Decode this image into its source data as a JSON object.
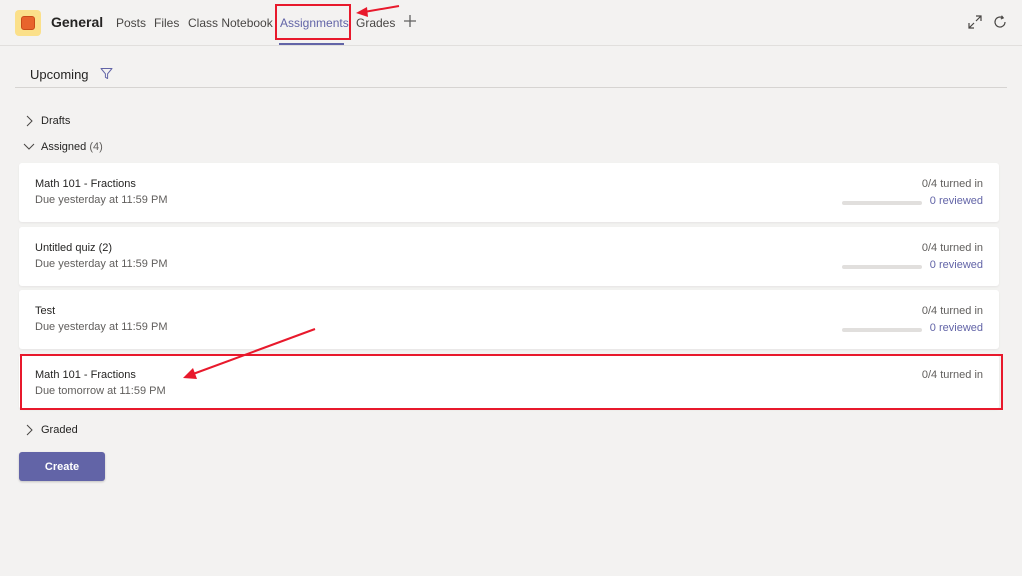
{
  "header": {
    "channel_name": "General",
    "tabs": [
      {
        "label": "Posts",
        "active": false
      },
      {
        "label": "Files",
        "active": false
      },
      {
        "label": "Class Notebook",
        "active": false
      },
      {
        "label": "Assignments",
        "active": true
      },
      {
        "label": "Grades",
        "active": false
      }
    ],
    "icons": [
      "add-tab-icon",
      "expand-icon",
      "refresh-icon"
    ]
  },
  "main": {
    "heading": "Upcoming",
    "sections": {
      "drafts": {
        "label": "Drafts",
        "expanded": false
      },
      "assigned": {
        "label": "Assigned",
        "count": "(4)",
        "expanded": true
      },
      "graded": {
        "label": "Graded",
        "expanded": false
      }
    },
    "assignments": [
      {
        "title": "Math 101 - Fractions",
        "due": "Due yesterday at 11:59 PM",
        "turned_in": "0/4 turned in",
        "reviewed": "0 reviewed",
        "progress": 0
      },
      {
        "title": "Untitled quiz (2)",
        "due": "Due yesterday at 11:59 PM",
        "turned_in": "0/4 turned in",
        "reviewed": "0 reviewed",
        "progress": 0
      },
      {
        "title": "Test",
        "due": "Due yesterday at 11:59 PM",
        "turned_in": "0/4 turned in",
        "reviewed": "0 reviewed",
        "progress": 0
      },
      {
        "title": "Math 101 - Fractions",
        "due": "Due tomorrow at 11:59 PM",
        "turned_in": "0/4 turned in"
      }
    ],
    "create_label": "Create"
  },
  "colors": {
    "accent": "#6264a7",
    "annotation": "#e8192c",
    "background": "#f3f2f1"
  }
}
